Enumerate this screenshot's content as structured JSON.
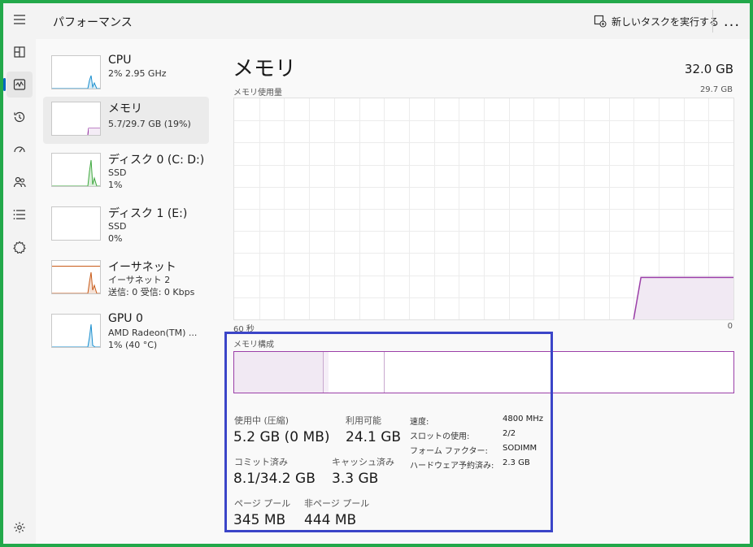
{
  "header": {
    "app_title": "パフォーマンス",
    "new_task_label": "新しいタスクを実行する",
    "more_label": "..."
  },
  "rail": {
    "items": [
      {
        "icon": "hamburger-menu-icon"
      },
      {
        "icon": "processes-icon"
      },
      {
        "icon": "performance-icon",
        "active": true
      },
      {
        "icon": "app-history-icon"
      },
      {
        "icon": "startup-apps-icon"
      },
      {
        "icon": "users-icon"
      },
      {
        "icon": "details-icon"
      },
      {
        "icon": "services-icon"
      },
      {
        "icon": "settings-icon"
      }
    ]
  },
  "devices": [
    {
      "title": "CPU",
      "sub1": "2%  2.95 GHz",
      "sub2": "",
      "sub3": "",
      "color": "#1a8fcf"
    },
    {
      "title": "メモリ",
      "sub1": "5.7/29.7 GB (19%)",
      "sub2": "",
      "sub3": "",
      "color": "#9b3fa8",
      "selected": true
    },
    {
      "title": "ディスク 0 (C: D:)",
      "sub1": "SSD",
      "sub2": "1%",
      "sub3": "",
      "color": "#3fa83f"
    },
    {
      "title": "ディスク 1 (E:)",
      "sub1": "SSD",
      "sub2": "0%",
      "sub3": "",
      "color": "#3fa83f"
    },
    {
      "title": "イーサネット",
      "sub1": "イーサネット 2",
      "sub2": "送信: 0 受信: 0 Kbps",
      "sub3": "",
      "color": "#c85a18"
    },
    {
      "title": "GPU 0",
      "sub1": "AMD Radeon(TM) ...",
      "sub2": "1%  (40 °C)",
      "sub3": "",
      "color": "#1a8fcf"
    }
  ],
  "memory": {
    "title": "メモリ",
    "total": "32.0 GB",
    "usage_label": "メモリ使用量",
    "usage_max": "29.7 GB",
    "time_left": "60 秒",
    "time_right": "0",
    "composition_label": "メモリ構成",
    "composition": {
      "in_use_fraction": 0.177,
      "modified_fraction": 0.012,
      "standby_fraction": 0.111
    },
    "usage_level_fraction": 0.19,
    "stats": {
      "in_use_label": "使用中 (圧縮)",
      "in_use_value": "5.2 GB (0 MB)",
      "available_label": "利用可能",
      "available_value": "24.1 GB",
      "committed_label": "コミット済み",
      "committed_value": "8.1/34.2 GB",
      "cached_label": "キャッシュ済み",
      "cached_value": "3.3 GB",
      "paged_label": "ページ プール",
      "paged_value": "345 MB",
      "nonpaged_label": "非ページ プール",
      "nonpaged_value": "444 MB"
    },
    "specs": [
      {
        "label": "速度:",
        "value": "4800 MHz"
      },
      {
        "label": "スロットの使用:",
        "value": "2/2"
      },
      {
        "label": "フォーム ファクター:",
        "value": "SODIMM"
      },
      {
        "label": "ハードウェア予約済み:",
        "value": "2.3 GB"
      }
    ]
  },
  "colors": {
    "memory_accent": "#9b3fa8",
    "memory_fill": "#f1e9f3",
    "highlight_box": "#3b45c8",
    "frame": "#22a84a"
  }
}
